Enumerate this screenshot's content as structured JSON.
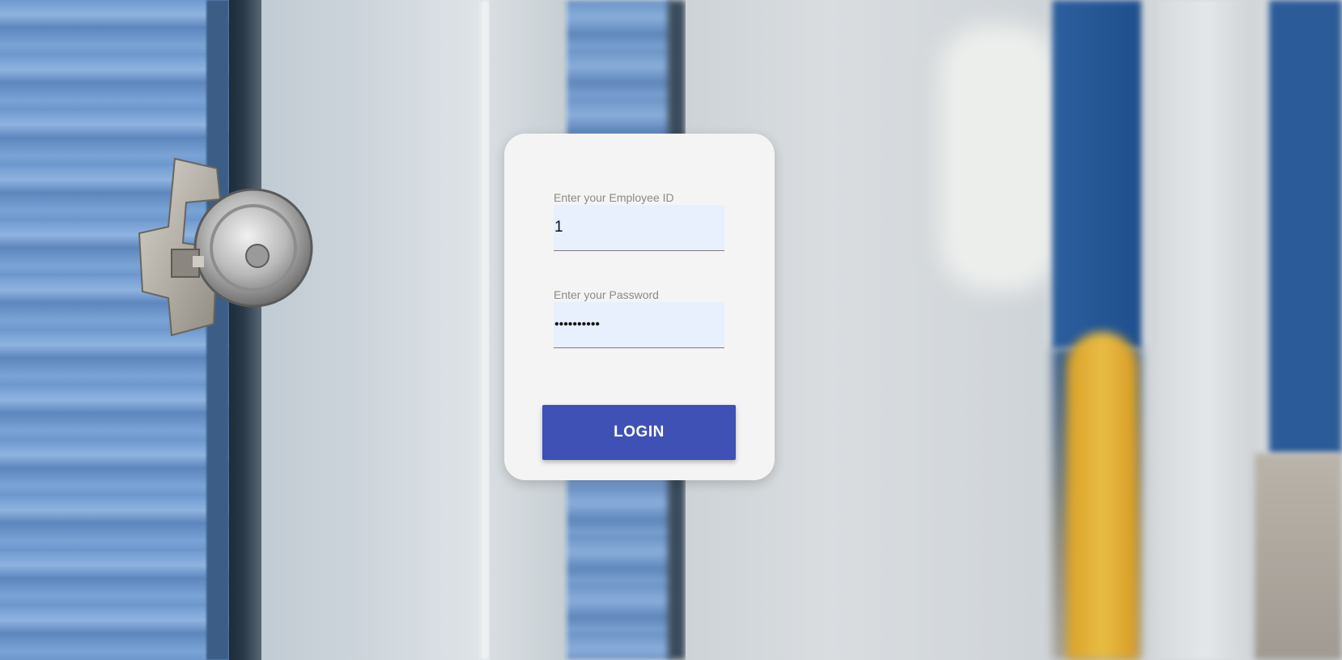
{
  "login_form": {
    "employee_id": {
      "label": "Enter your Employee ID",
      "value": "1"
    },
    "password": {
      "label": "Enter your Password",
      "value": "••••••••••"
    },
    "login_button_label": "LOGIN"
  },
  "colors": {
    "button": "#3f51b5",
    "card_background": "#f4f4f4",
    "input_autofill_background": "#e8f0fe"
  },
  "background": {
    "description_icon": "storage-unit-padlock-photo"
  }
}
